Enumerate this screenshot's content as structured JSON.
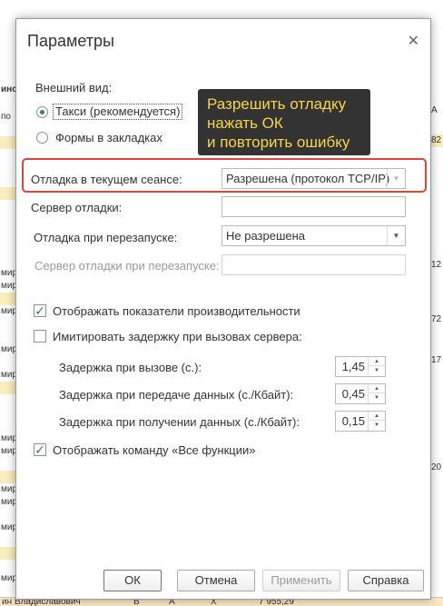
{
  "background": {
    "rows": [
      "ино",
      "по",
      "мир",
      "мир",
      "мир",
      "мир",
      "мир",
      "мир",
      "мир",
      "мир",
      "мир",
      "мир",
      "мир",
      "мир",
      "мир",
      "мир",
      "мир",
      "мир",
      "мир",
      "мир",
      "мир",
      "мир"
    ],
    "right_cells": [
      "A",
      "82",
      "12",
      "72",
      "17",
      "20"
    ],
    "footer": {
      "name": "ин Владиславович",
      "c1": "B",
      "c2": "A",
      "c3": "X",
      "amount": "7 955,29"
    }
  },
  "dialog": {
    "title": "Параметры",
    "appearance_label": "Внешний вид:",
    "radio_taxi": "Такси (рекомендуется)",
    "radio_tabs": "Формы в закладках",
    "tooltip_lines": [
      "Разрешить отладку",
      "нажать ОК",
      "и повторить ошибку"
    ],
    "debug_current_label": "Отладка в текущем сеансе:",
    "debug_current_value": "Разрешена (протокол TCP/IP)",
    "debug_server_label": "Сервер отладки:",
    "debug_server_value": "",
    "debug_restart_label": "Отладка при перезапуске:",
    "debug_restart_value": "Не разрешена",
    "debug_restart_server_label": "Сервер отладки при перезапуске:",
    "debug_restart_server_value": "",
    "show_perf_label": "Отображать показатели производительности",
    "show_perf_checked": true,
    "simulate_delay_label": "Имитировать задержку при вызовах сервера:",
    "simulate_delay_checked": false,
    "delay_call_label": "Задержка при вызове (с.):",
    "delay_call_value": "1,45",
    "delay_send_label": "Задержка при передаче данных (с./Кбайт):",
    "delay_send_value": "0,45",
    "delay_recv_label": "Задержка при получении данных (с./Кбайт):",
    "delay_recv_value": "0,15",
    "show_all_funcs_label": "Отображать команду «Все функции»",
    "show_all_funcs_checked": true
  },
  "buttons": {
    "ok": "ОК",
    "cancel": "Отмена",
    "apply": "Применить",
    "help": "Справка"
  },
  "colors": {
    "accent_green": "#2a8a3e",
    "highlight_red": "#d9463d",
    "tooltip_bg": "#333333",
    "tooltip_text": "#f5d64a"
  }
}
